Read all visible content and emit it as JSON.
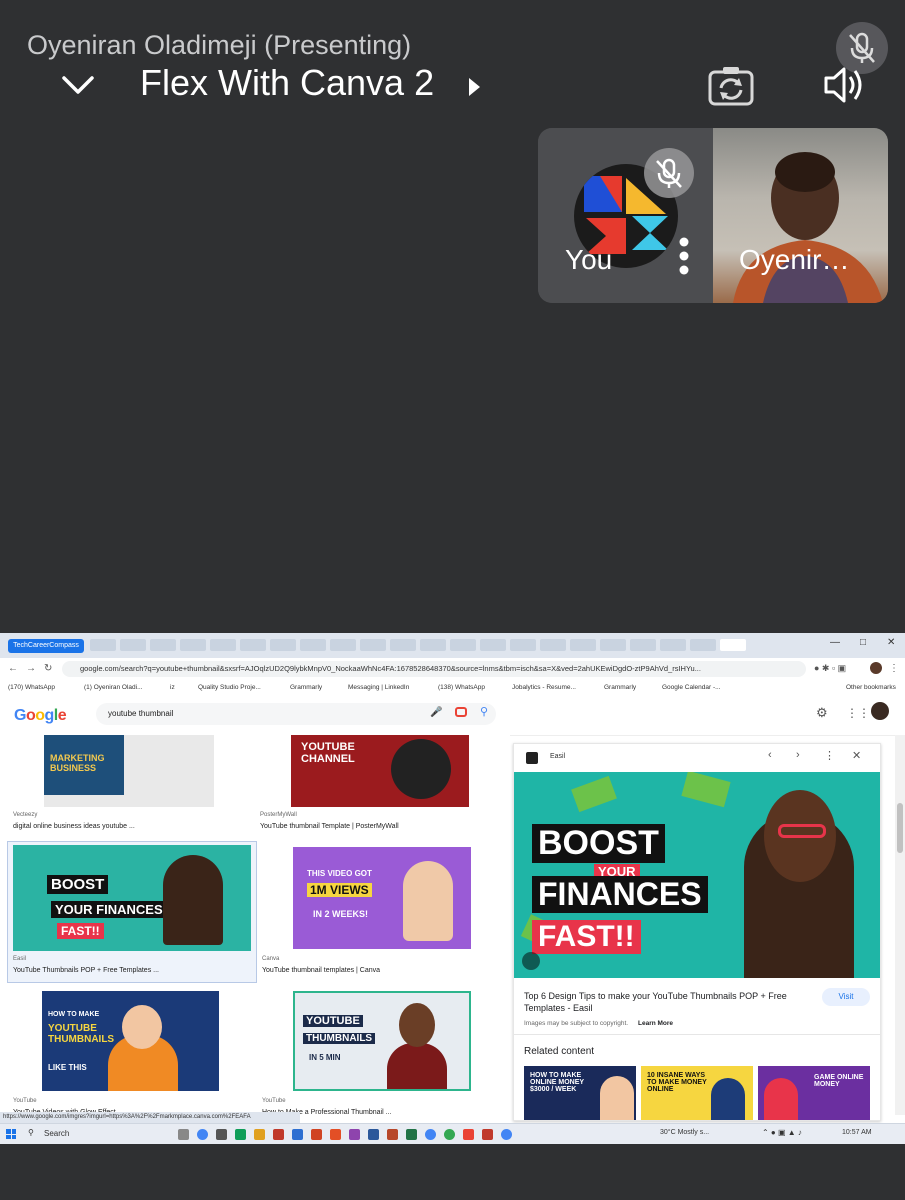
{
  "call": {
    "presenter": "Oyeniran Oladimeji (Presenting)",
    "meeting_title": "Flex With Canva 2",
    "you_label": "You",
    "other_participant": "Oyenir…"
  },
  "browser": {
    "tab_label": "TechCareerCompass",
    "url": "google.com/search?q=youtube+thumbnail&sxsrf=AJOqlzUD2Q9lybkMnpV0_NockaaWhNc4FA:1678528648370&source=lnms&tbm=isch&sa=X&ved=2ahUKEwiDgdO-ztP9AhVd_rsIHYu...",
    "bookmarks": [
      "(170) WhatsApp",
      "(1) Oyeniran Oladi...",
      "iz",
      "Quality Studio Proje...",
      "Grammarly",
      "Messaging | LinkedIn",
      "(138) WhatsApp",
      "Jobalytics - Resume...",
      "Grammarly",
      "Google Calendar -...",
      "Other bookmarks"
    ],
    "status_url": "https://www.google.com/imgres?imgurl=https%3A%2F%2Fmarkmplace.canva.com%2FEAFA"
  },
  "google": {
    "logo": "Google",
    "query": "youtube thumbnail"
  },
  "results": [
    {
      "source": "Vecteezy",
      "title": "digital online business ideas youtube ...",
      "thumb_text": "MARKETING BUSINESS"
    },
    {
      "source": "PosterMyWall",
      "title": "YouTube thumbnail Template | PosterMyWall",
      "thumb_text": "YOUTUBE CHANNEL"
    },
    {
      "source": "Easil",
      "title": "YouTube Thumbnails POP + Free Templates ...",
      "thumb_text": [
        "BOOST",
        "YOUR FINANCES",
        "FAST!!"
      ]
    },
    {
      "source": "Canva",
      "title": "YouTube thumbnail templates | Canva",
      "thumb_text": [
        "THIS VIDEO GOT",
        "1M VIEWS",
        "IN 2 WEEKS!"
      ]
    },
    {
      "source": "YouTube",
      "title": "YouTube Videos with Glow Effect ...",
      "thumb_text": [
        "HOW TO MAKE",
        "YOUTUBE THUMBNAILS",
        "LIKE THIS"
      ]
    },
    {
      "source": "YouTube",
      "title": "How to Make a Professional Thumbnail ...",
      "thumb_text": [
        "YOUTUBE",
        "THUMBNAILS",
        "IN 5 MIN"
      ]
    }
  ],
  "panel": {
    "source": "Easil",
    "image_text": [
      "BOOST",
      "YOUR",
      "FINANCES",
      "FAST!!"
    ],
    "title": "Top 6 Design Tips to make your YouTube Thumbnails POP + Free Templates - Easil",
    "visit": "Visit",
    "copyright": "Images may be subject to copyright.",
    "learn_more": "Learn More",
    "related": "Related content",
    "related_items": [
      "HOW TO MAKE ONLINE MONEY $3000 / WEEK",
      "10 INSANE WAYS TO MAKE MONEY ONLINE",
      "GAME ONLINE MONEY"
    ]
  },
  "taskbar": {
    "search": "Search",
    "weather": "30°C  Mostly s...",
    "time": "10:57 AM"
  }
}
